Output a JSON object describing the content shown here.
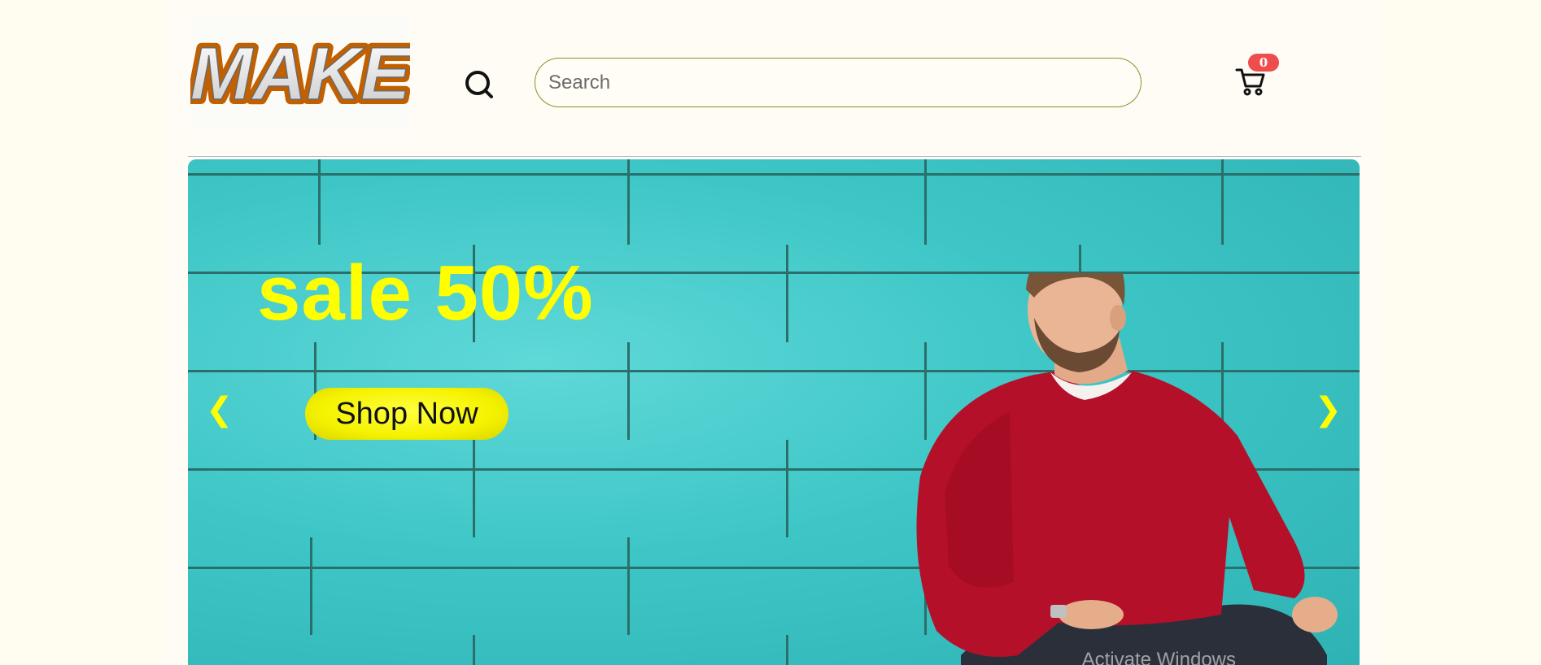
{
  "header": {
    "logo_text": "MAKE",
    "search": {
      "placeholder": "Search",
      "value": ""
    },
    "cart": {
      "count": "0"
    }
  },
  "banner": {
    "headline": "sale 50%",
    "cta_label": "Shop Now",
    "prev_label": "❮",
    "next_label": "❯"
  },
  "os_overlay": {
    "watermark": "Activate Windows"
  },
  "icons": [
    "search-icon",
    "cart-icon",
    "chevron-left-icon",
    "chevron-right-icon"
  ],
  "colors": {
    "page_bg": "#fffcf5",
    "accent_yellow": "#ffff00",
    "banner_teal": "#3ec6c6",
    "badge_red": "#ef4d4d",
    "search_border": "#8a8f2a"
  }
}
